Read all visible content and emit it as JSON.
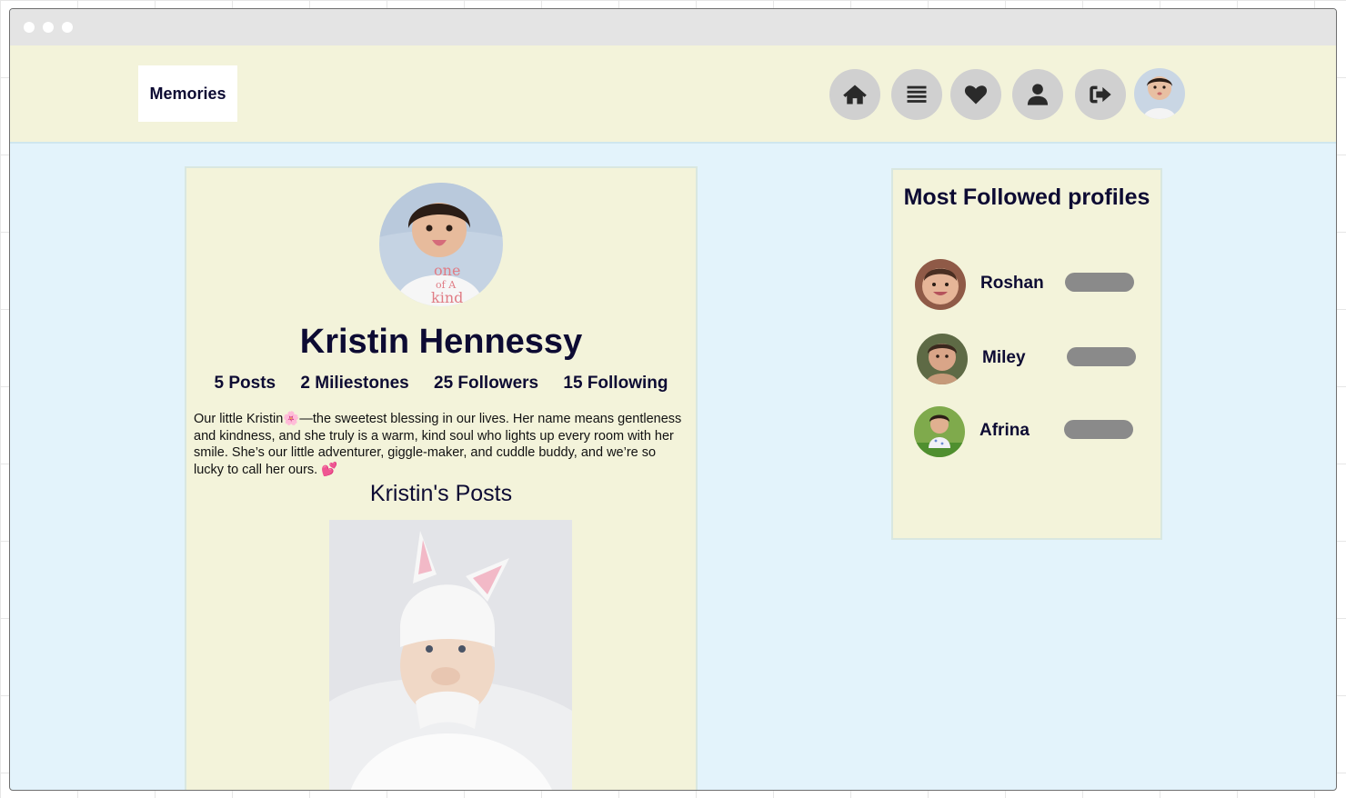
{
  "nav": {
    "logo": "Memories",
    "icons": [
      "home-icon",
      "list-icon",
      "heart-icon",
      "user-icon",
      "sign-out-icon"
    ]
  },
  "profile": {
    "name": "Kristin Hennessy",
    "stats": {
      "posts": "5 Posts",
      "milestones": "2 Miliestones",
      "followers": "25 Followers",
      "following": "15 Following"
    },
    "bio": "Our little Kristin🌸—the sweetest blessing in our lives. Her name means gentleness and kindness, and she truly is a warm, kind soul who lights up every room with her smile. She’s our little adventurer, giggle-maker, and cuddle buddy, and we’re so lucky to call her ours. 💕",
    "posts_title": "Kristin's Posts"
  },
  "sidebar": {
    "title": "Most Followed profiles",
    "profiles": [
      {
        "name": "Roshan"
      },
      {
        "name": "Miley"
      },
      {
        "name": "Afrina"
      }
    ]
  },
  "colors": {
    "navbar_bg": "#f3f3da",
    "page_bg": "#e3f3fb",
    "text_dark": "#0d0b33",
    "icon_circle": "#d0d0d0",
    "follow_button": "#8a8a8a"
  }
}
